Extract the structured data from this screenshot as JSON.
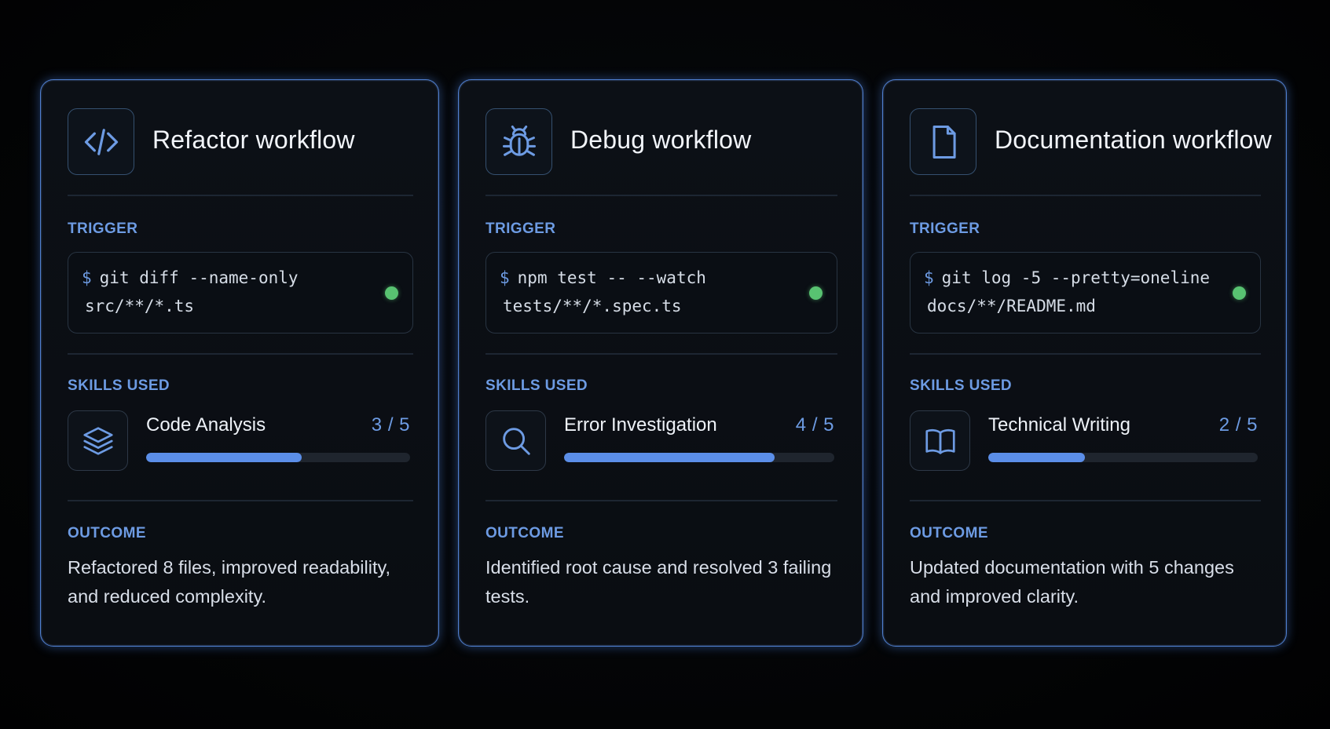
{
  "colors": {
    "accent": "#6d9be3",
    "card_border": "#4f7fd0",
    "progress_fill": "#5b8ee8",
    "status_ok": "#58c271",
    "background": "#030405"
  },
  "section_labels": {
    "trigger": "TRIGGER",
    "skills": "SKILLS USED",
    "outcome": "OUTCOME"
  },
  "prompt_symbol": "$",
  "cards": [
    {
      "icon": "code-icon",
      "title": "Refactor workflow",
      "trigger": {
        "command": "git diff --name-only",
        "path": "src/**/*.ts",
        "status": "active"
      },
      "skill": {
        "icon": "layers-icon",
        "name": "Code Analysis",
        "score_text": "3 / 5",
        "progress": 0.59
      },
      "outcome": "Refactored 8 files, improved readability, and reduced complexity."
    },
    {
      "icon": "bug-icon",
      "title": "Debug workflow",
      "trigger": {
        "command": "npm test -- --watch",
        "path": "tests/**/*.spec.ts",
        "status": "active"
      },
      "skill": {
        "icon": "search-icon",
        "name": "Error Investigation",
        "score_text": "4 / 5",
        "progress": 0.78
      },
      "outcome": "Identified root cause and resolved 3 failing tests."
    },
    {
      "icon": "document-icon",
      "title": "Documentation workflow",
      "trigger": {
        "command": "git log -5 --pretty=oneline",
        "path": "docs/**/README.md",
        "status": "active"
      },
      "skill": {
        "icon": "book-icon",
        "name": "Technical Writing",
        "score_text": "2 / 5",
        "progress": 0.36
      },
      "outcome": "Updated documentation with 5 changes and improved clarity."
    }
  ]
}
